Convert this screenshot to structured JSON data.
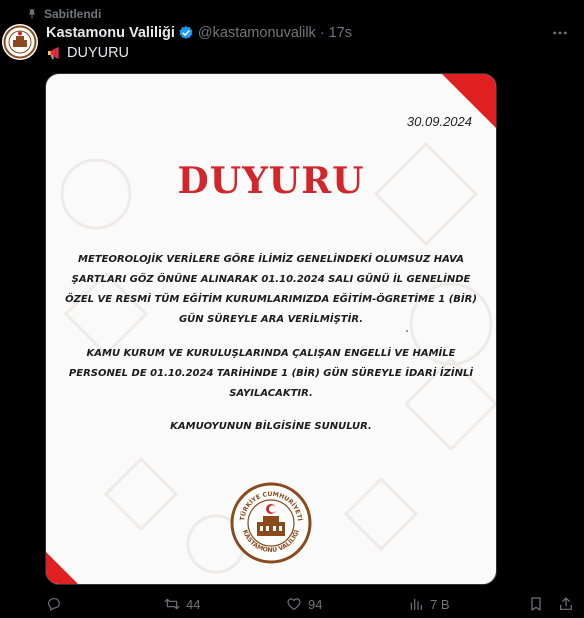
{
  "pinned": {
    "label": "Sabitlendi",
    "icon": "pin-icon"
  },
  "tweet": {
    "author": {
      "display_name": "Kastamonu Valiliği",
      "handle": "@kastamonuvalilk",
      "verified": true,
      "avatar_icon": "seal-avatar-icon"
    },
    "separator": "·",
    "time": "17s",
    "text": "DUYURU",
    "text_icon": "megaphone-icon"
  },
  "media": {
    "date": "30.09.2024",
    "title": "DUYURU",
    "paragraph1": "METEOROLOJİK VERİLERE GÖRE İLİMİZ GENELİNDEKİ OLUMSUZ HAVA ŞARTLARI GÖZ ÖNÜNE ALINARAK 01.10.2024 SALI GÜNÜ İL GENELİNDE ÖZEL VE RESMİ TÜM EĞİTİM KURUMLARIMIZDA EĞİTİM-ÖGRETİME 1 (BİR) GÜN SÜREYLE ARA VERİLMİŞTİR.",
    "paragraph2": "KAMU KURUM VE KURULUŞLARINDA ÇALIŞAN ENGELLİ VE HAMİLE PERSONEL DE 01.10.2024 TARİHİNDE 1 (BİR) GÜN SÜREYLE İDARİ İZİNLİ SAYILACAKTIR.",
    "paragraph3": "KAMUOYUNUN BİLGİSİNE SUNULUR.",
    "seal_top": "TÜRKİYE CUMHURİYETİ",
    "seal_bottom": "KASTAMONU VALİLİĞİ",
    "accent_color": "#e02020",
    "title_color": "#d1262b"
  },
  "actions": {
    "reply": {
      "icon": "reply-icon",
      "count": ""
    },
    "repost": {
      "icon": "repost-icon",
      "count": "44"
    },
    "like": {
      "icon": "heart-icon",
      "count": "94"
    },
    "views": {
      "icon": "views-icon",
      "count": "7 B"
    },
    "bookmark": {
      "icon": "bookmark-icon"
    },
    "share": {
      "icon": "share-icon"
    }
  },
  "colors": {
    "background": "#000000",
    "text": "#e7e9ea",
    "muted": "#71767b",
    "verified": "#1d9bf0"
  }
}
